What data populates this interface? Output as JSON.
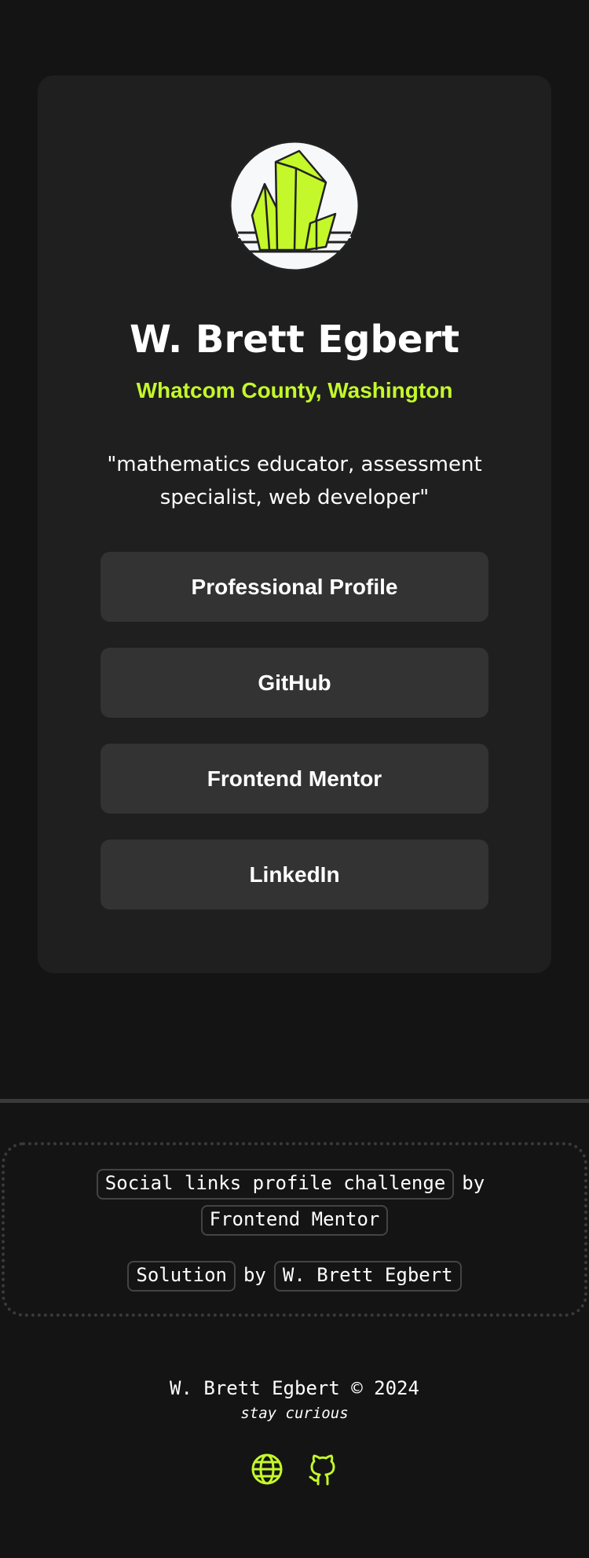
{
  "profile": {
    "name": "W. Brett Egbert",
    "location": "Whatcom County, Washington",
    "bio": "\"mathematics educator, assessment specialist, web developer\""
  },
  "links": [
    {
      "label": "Professional Profile"
    },
    {
      "label": "GitHub"
    },
    {
      "label": "Frontend Mentor"
    },
    {
      "label": "LinkedIn"
    }
  ],
  "attribution": {
    "challenge_label": "Social links profile challenge",
    "by_1": "by",
    "provider_label": "Frontend Mentor",
    "solution_label": "Solution",
    "by_2": "by",
    "author_label": "W. Brett Egbert"
  },
  "footer": {
    "copyright": "W. Brett Egbert © 2024",
    "tagline": "stay curious",
    "icons": [
      "globe-icon",
      "github-icon"
    ]
  },
  "colors": {
    "background": "#141414",
    "card": "#1f1f1f",
    "button": "#333333",
    "accent": "#c4f82a"
  }
}
